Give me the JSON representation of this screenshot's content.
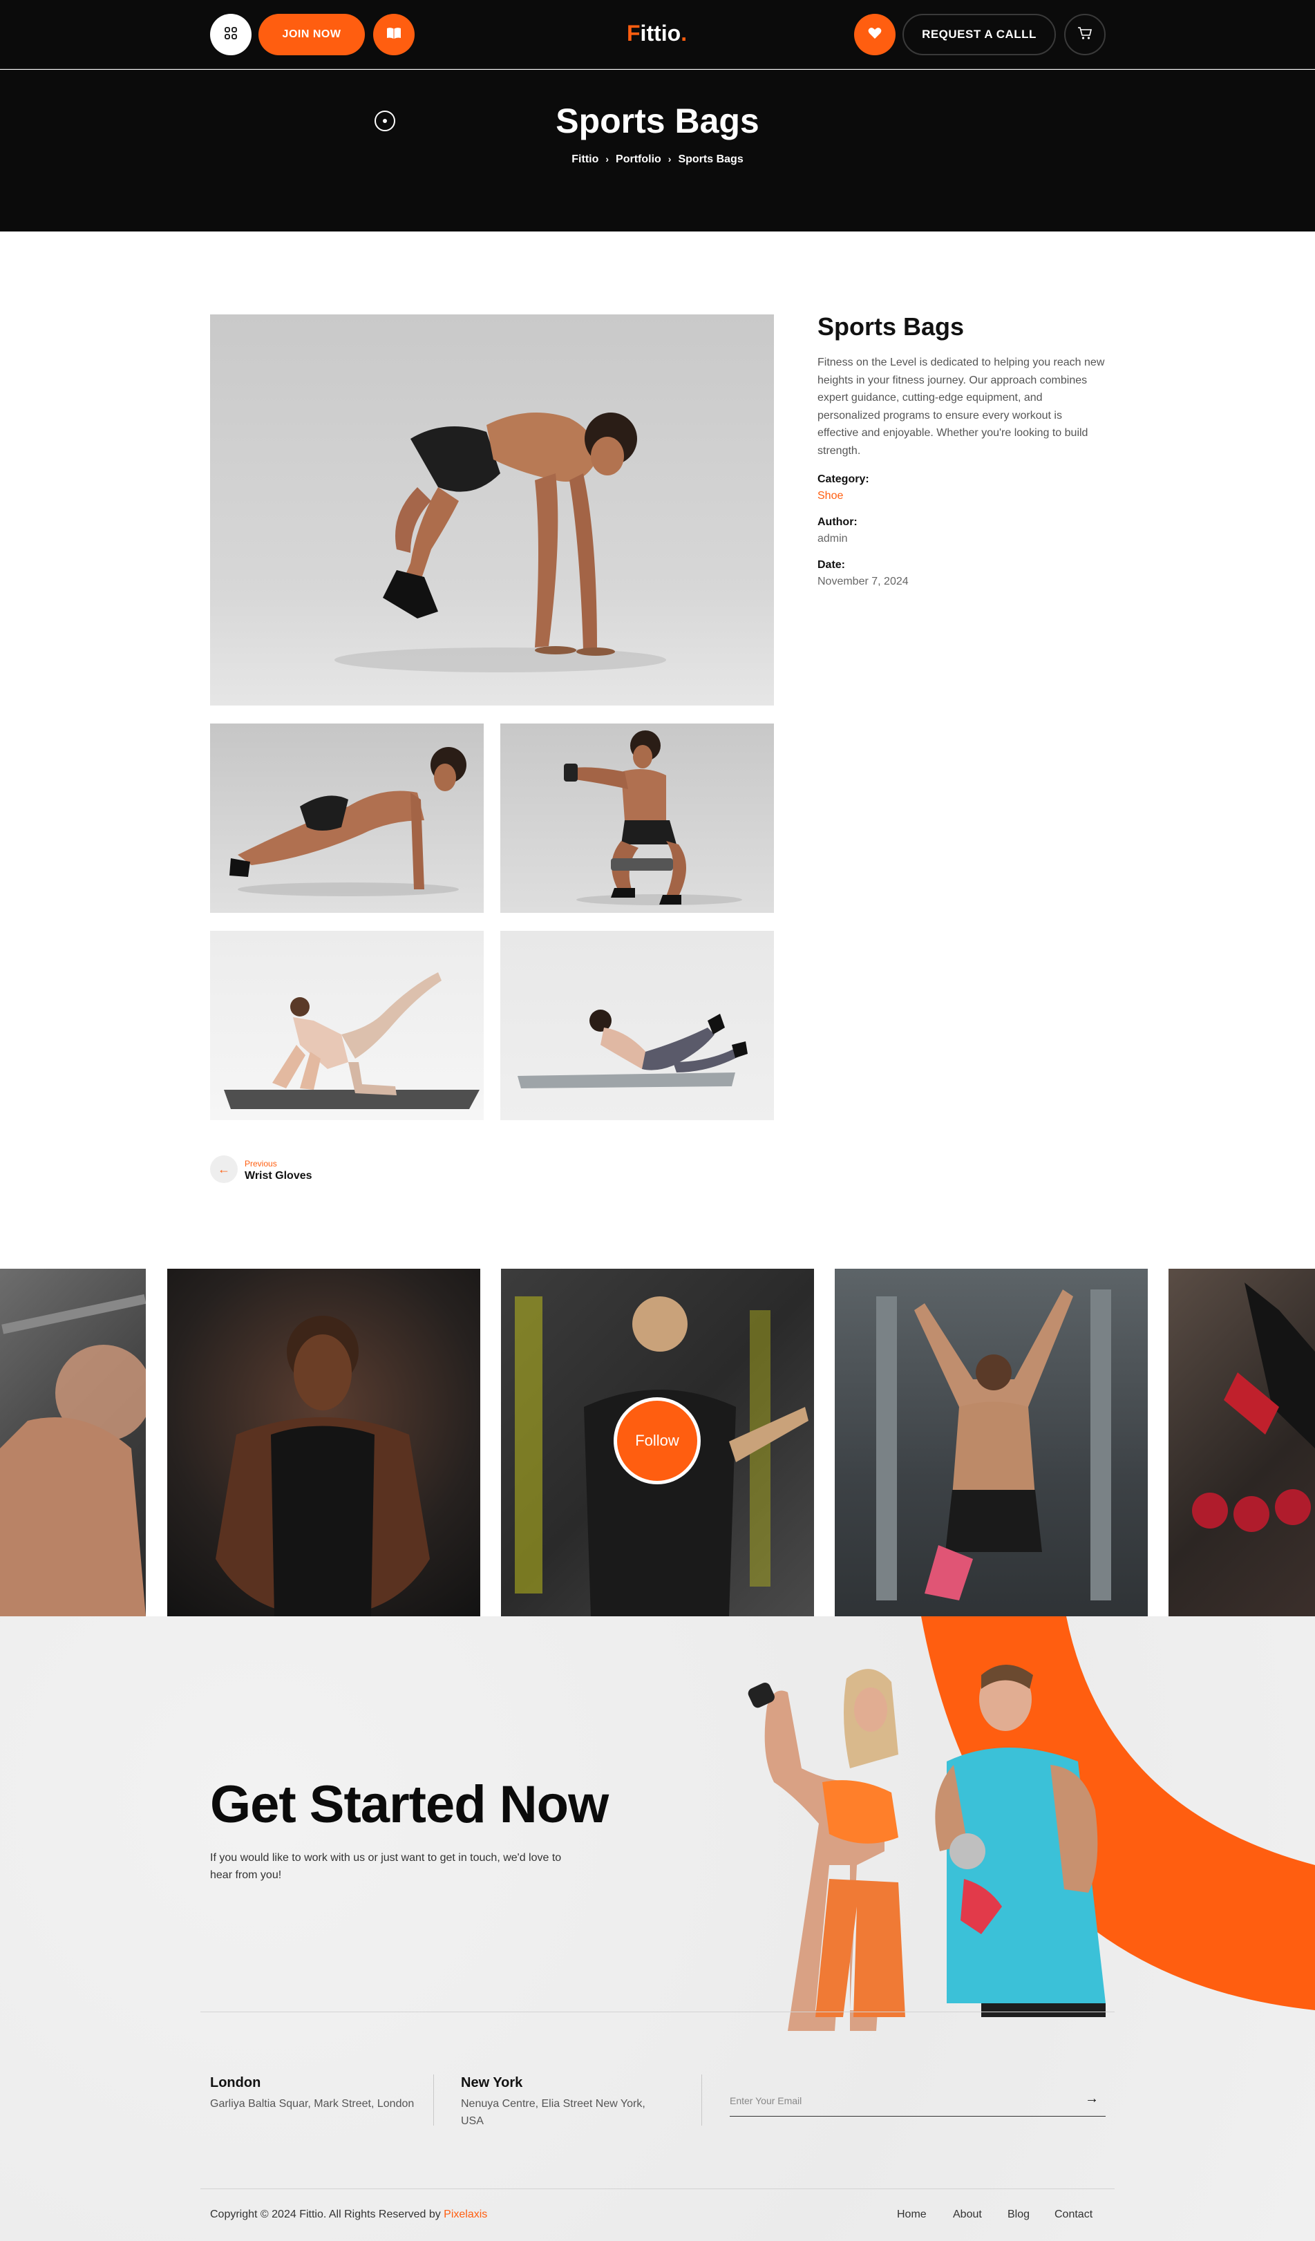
{
  "header": {
    "logo_first": "F",
    "logo_rest": "ittio",
    "logo_dot": ".",
    "join_label": "JOIN NOW",
    "call_label": "REQUEST A CALLL",
    "menu_icon": "grid-icon",
    "book_icon": "book-icon",
    "heart_icon": "heart-icon",
    "cart_icon": "cart-icon",
    "accent_color": "#ff5e10"
  },
  "hero": {
    "title": "Sports Bags",
    "breadcrumb": [
      "Fittio",
      "Portfolio",
      "Sports Bags"
    ]
  },
  "detail": {
    "title": "Sports Bags",
    "description": "Fitness on the Level is dedicated to helping you reach new heights in your fitness journey. Our approach combines expert guidance, cutting-edge equipment, and personalized programs to ensure every workout is effective and enjoyable. Whether you're looking to build strength.",
    "category_label": "Category:",
    "category_value": "Shoe",
    "author_label": "Author:",
    "author_value": "admin",
    "date_label": "Date:",
    "date_value": "November 7, 2024"
  },
  "nav": {
    "previous_label": "Previous",
    "previous_title": "Wrist Gloves"
  },
  "gallery": {
    "follow_label": "Follow"
  },
  "cta": {
    "title": "Get Started Now",
    "text": "If you would like to work with us or just want to get in touch, we'd love to hear from you!"
  },
  "footer": {
    "locations": [
      {
        "city": "London",
        "address": "Garliya Baltia Squar, Mark Street, London"
      },
      {
        "city": "New York",
        "address": "Nenuya Centre, Elia Street New York, USA"
      }
    ],
    "email_placeholder": "Enter Your Email",
    "copyright_prefix": "Copyright © 2024 Fittio. All Rights Reserved by ",
    "copyright_brand": "Pixelaxis",
    "links": [
      "Home",
      "About",
      "Blog",
      "Contact"
    ]
  }
}
